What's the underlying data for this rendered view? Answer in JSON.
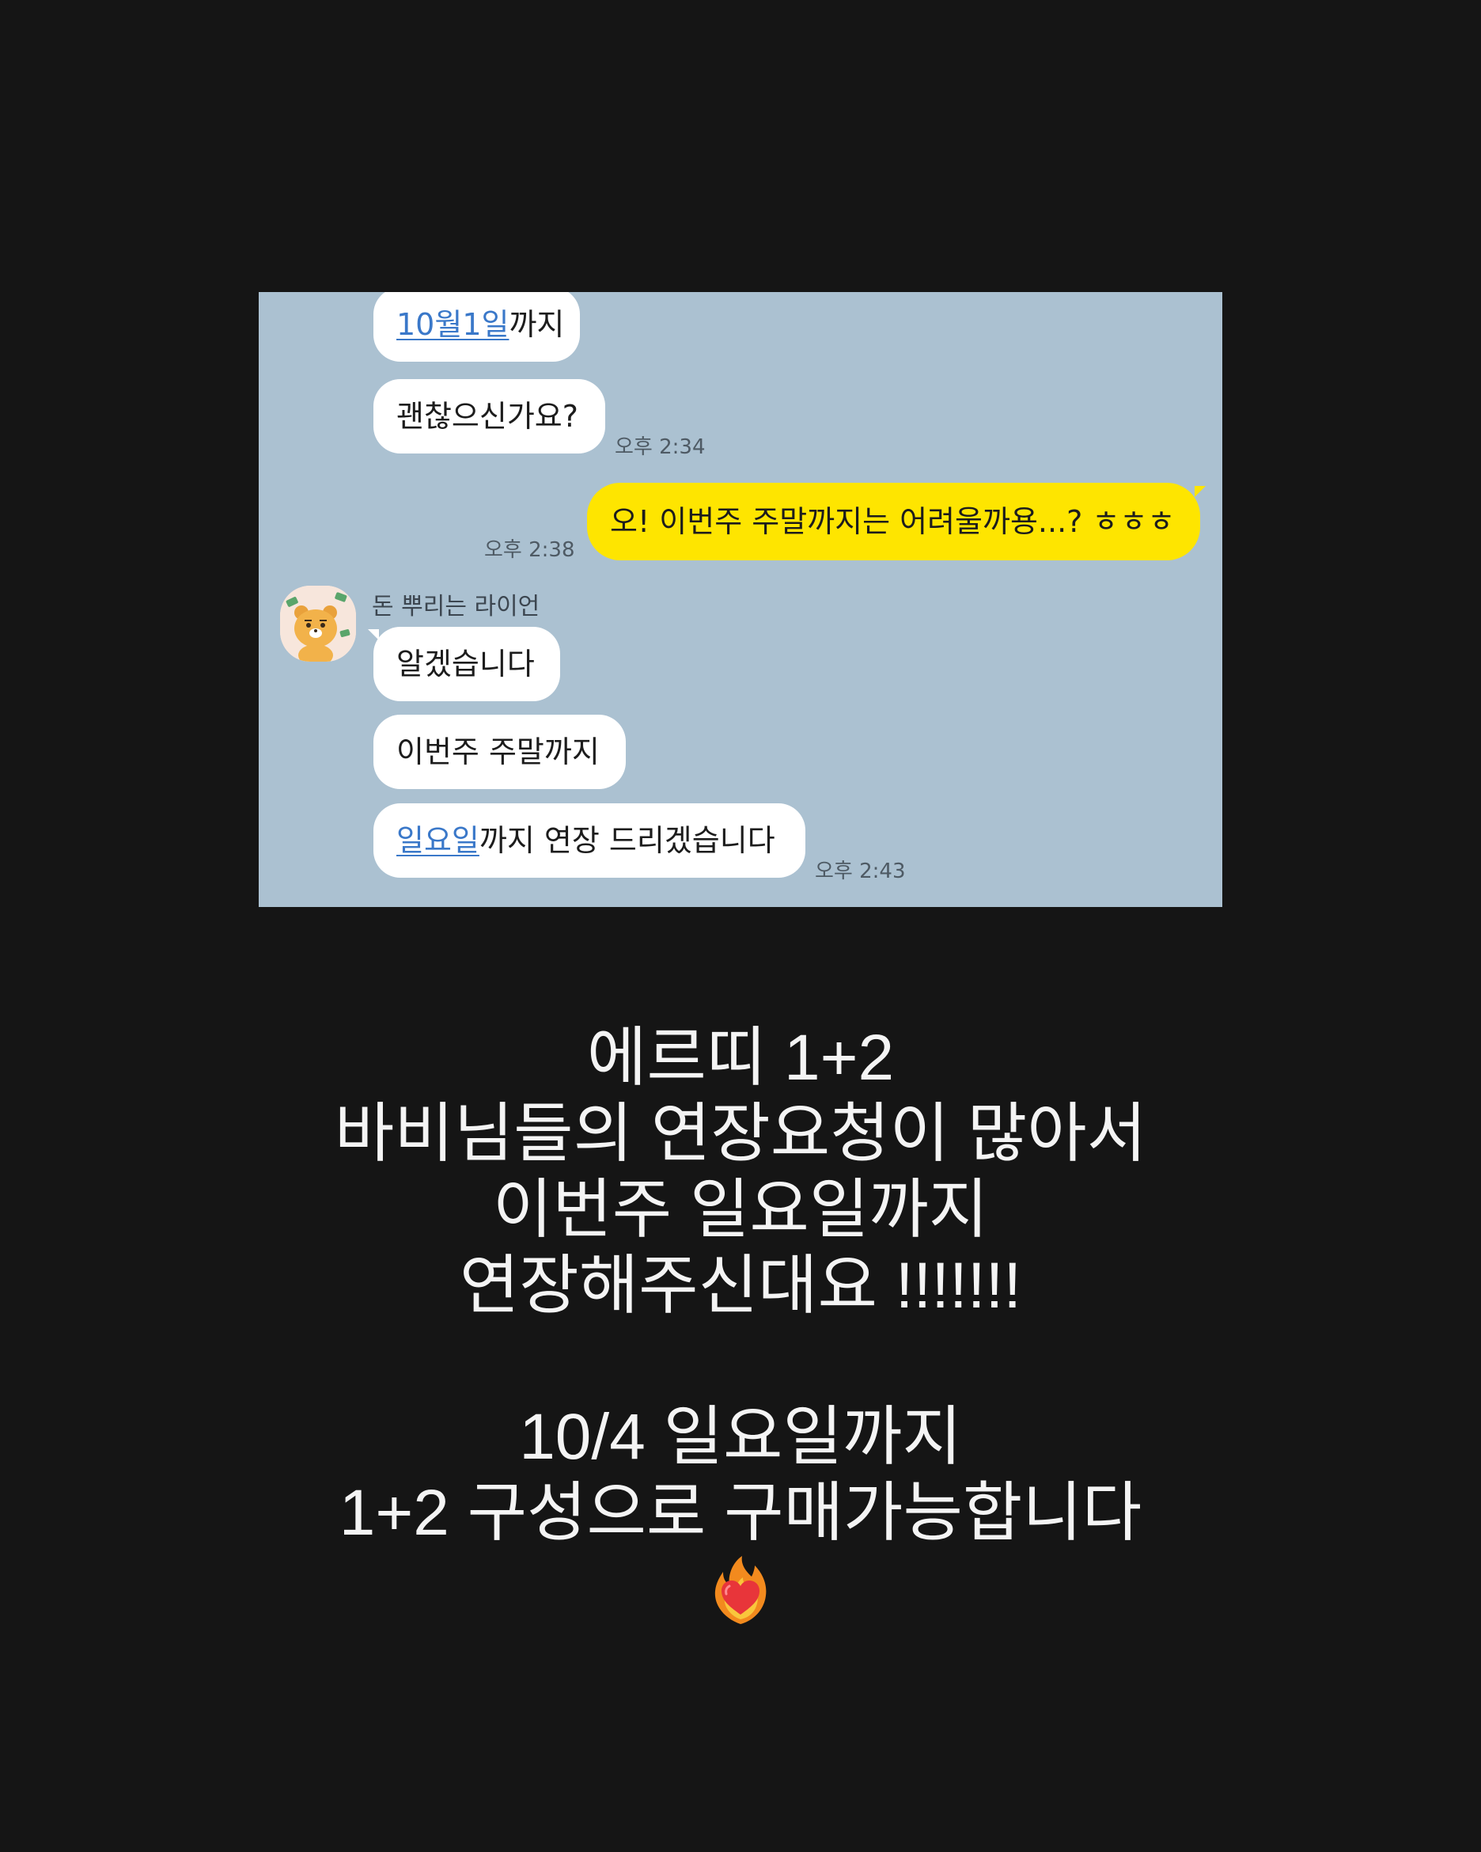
{
  "chat": {
    "messages": {
      "m1_link": "10월1일",
      "m1_rest": "까지",
      "m2": "괜찮으신가요?",
      "t1": "오후 2:34",
      "m3": "오! 이번주 주말까지는 어려울까용...? ㅎㅎㅎ",
      "t2": "오후 2:38",
      "sender": "돈 뿌리는 라이언",
      "m4": "알겠습니다",
      "m5": "이번주 주말까지",
      "m6_link": "일요일",
      "m6_rest": "까지 연장 드리겠습니다",
      "t3": "오후 2:43"
    },
    "avatar_icon": "ryan-character-icon",
    "colors": {
      "background": "#abc1d1",
      "incoming_bubble": "#ffffff",
      "outgoing_bubble": "#fee500",
      "link": "#3a78c9"
    }
  },
  "caption": {
    "block1": [
      "에르띠 1+2",
      "바비님들의 연장요청이 많아서",
      "이번주 일요일까지",
      "연장해주신대요 !!!!!!!"
    ],
    "block2_line1": "10/4 일요일까지",
    "block2_line2": "1+2 구성으로 구매가능합니다",
    "emoji": "heart-on-fire-icon"
  }
}
